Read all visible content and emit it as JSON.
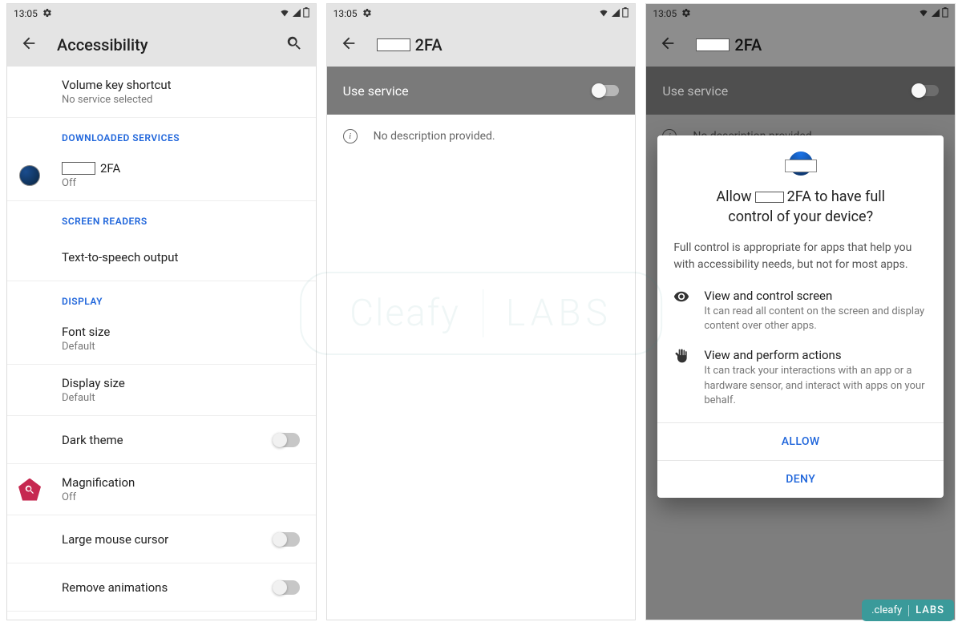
{
  "status": {
    "time": "13:05"
  },
  "screen1": {
    "title": "Accessibility",
    "settings": {
      "volume": {
        "title": "Volume key shortcut",
        "sub": "No service selected"
      },
      "section_downloaded": "DOWNLOADED SERVICES",
      "app2fa": {
        "title": "2FA",
        "sub": "Off"
      },
      "section_readers": "SCREEN READERS",
      "tts": {
        "title": "Text-to-speech output"
      },
      "section_display": "DISPLAY",
      "font": {
        "title": "Font size",
        "sub": "Default"
      },
      "dispsize": {
        "title": "Display size",
        "sub": "Default"
      },
      "dark": {
        "title": "Dark theme"
      },
      "magnify": {
        "title": "Magnification",
        "sub": "Off"
      },
      "cursor": {
        "title": "Large mouse cursor"
      },
      "anim": {
        "title": "Remove animations"
      }
    }
  },
  "screen2": {
    "title": "2FA",
    "service_label": "Use service",
    "no_desc": "No description provided."
  },
  "screen3": {
    "title": "2FA",
    "service_label": "Use service",
    "no_desc": "No description provided.",
    "dialog": {
      "title_pre": "Allow",
      "title_post": "2FA to have full",
      "title_line2": "control of your device?",
      "body": "Full control is appropriate for apps that help you with accessibility needs, but not for most apps.",
      "perm1": {
        "title": "View and control screen",
        "desc": "It can read all content on the screen and display content over other apps."
      },
      "perm2": {
        "title": "View and perform actions",
        "desc": "It can track your interactions with an app or a hardware sensor, and interact with apps on your behalf."
      },
      "allow": "ALLOW",
      "deny": "DENY"
    }
  },
  "watermark": {
    "left": "Cleafy",
    "right": "LABS"
  },
  "badge": {
    "brand": ".cleafy",
    "lab": "LABS"
  }
}
